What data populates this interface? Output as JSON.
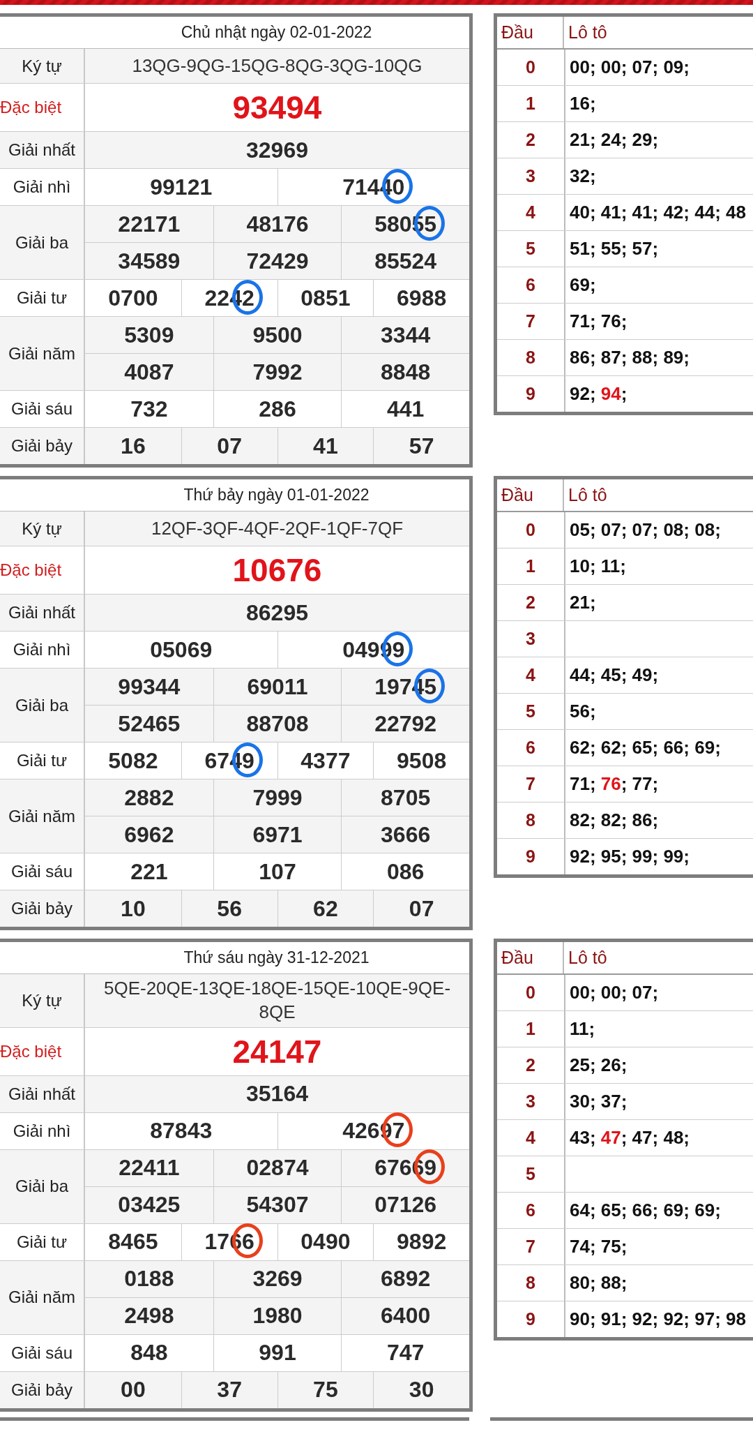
{
  "draws": [
    {
      "date_title": "Chủ nhật ngày 02-01-2022",
      "color": "#1a73e8",
      "prizes": [
        {
          "label": "Ký tự",
          "kind": "symbols",
          "rows": [
            [
              {
                "n": "13QG-9QG-15QG-8QG-3QG-10QG",
                "circled": false
              }
            ]
          ]
        },
        {
          "label": "Đặc biệt",
          "kind": "special",
          "rows": [
            [
              {
                "n": "93494",
                "circled": false
              }
            ]
          ]
        },
        {
          "label": "Giải nhất",
          "kind": "normal",
          "rows": [
            [
              {
                "n": "32969",
                "circled": false
              }
            ]
          ]
        },
        {
          "label": "Giải nhì",
          "kind": "normal",
          "rows": [
            [
              {
                "n": "99121",
                "circled": false
              },
              {
                "n": "71440",
                "circled": true
              }
            ]
          ]
        },
        {
          "label": "Giải ba",
          "kind": "normal",
          "rows": [
            [
              {
                "n": "22171",
                "circled": false
              },
              {
                "n": "48176",
                "circled": false
              },
              {
                "n": "58055",
                "circled": true
              }
            ],
            [
              {
                "n": "34589",
                "circled": false
              },
              {
                "n": "72429",
                "circled": false
              },
              {
                "n": "85524",
                "circled": false
              }
            ]
          ]
        },
        {
          "label": "Giải tư",
          "kind": "normal",
          "rows": [
            [
              {
                "n": "0700",
                "circled": false
              },
              {
                "n": "2242",
                "circled": true
              },
              {
                "n": "0851",
                "circled": false
              },
              {
                "n": "6988",
                "circled": false
              }
            ]
          ]
        },
        {
          "label": "Giải năm",
          "kind": "normal",
          "rows": [
            [
              {
                "n": "5309",
                "circled": false
              },
              {
                "n": "9500",
                "circled": false
              },
              {
                "n": "3344",
                "circled": false
              }
            ],
            [
              {
                "n": "4087",
                "circled": false
              },
              {
                "n": "7992",
                "circled": false
              },
              {
                "n": "8848",
                "circled": false
              }
            ]
          ]
        },
        {
          "label": "Giải sáu",
          "kind": "normal",
          "rows": [
            [
              {
                "n": "732",
                "circled": false
              },
              {
                "n": "286",
                "circled": false
              },
              {
                "n": "441",
                "circled": false
              }
            ]
          ]
        },
        {
          "label": "Giải bảy",
          "kind": "normal",
          "rows": [
            [
              {
                "n": "16",
                "circled": false
              },
              {
                "n": "07",
                "circled": false
              },
              {
                "n": "41",
                "circled": false
              },
              {
                "n": "57",
                "circled": false
              }
            ]
          ]
        }
      ],
      "loto": {
        "head_label": "Đầu",
        "list_label": "Lô tô",
        "rows": [
          {
            "head": "0",
            "segments": [
              {
                "text": "00; 00; 07; 09;",
                "special": false
              }
            ]
          },
          {
            "head": "1",
            "segments": [
              {
                "text": "16;",
                "special": false
              }
            ]
          },
          {
            "head": "2",
            "segments": [
              {
                "text": "21; 24; 29;",
                "special": false
              }
            ]
          },
          {
            "head": "3",
            "segments": [
              {
                "text": "32;",
                "special": false
              }
            ]
          },
          {
            "head": "4",
            "segments": [
              {
                "text": "40; 41; 41; 42; 44; 48",
                "special": false
              }
            ]
          },
          {
            "head": "5",
            "segments": [
              {
                "text": "51; 55; 57;",
                "special": false
              }
            ]
          },
          {
            "head": "6",
            "segments": [
              {
                "text": "69;",
                "special": false
              }
            ]
          },
          {
            "head": "7",
            "segments": [
              {
                "text": "71; 76;",
                "special": false
              }
            ]
          },
          {
            "head": "8",
            "segments": [
              {
                "text": "86; 87; 88; 89;",
                "special": false
              }
            ]
          },
          {
            "head": "9",
            "segments": [
              {
                "text": "92; ",
                "special": false
              },
              {
                "text": "94",
                "special": true
              },
              {
                "text": ";",
                "special": false
              }
            ]
          }
        ]
      }
    },
    {
      "date_title": "Thứ bảy ngày 01-01-2022",
      "color": "#1a73e8",
      "prizes": [
        {
          "label": "Ký tự",
          "kind": "symbols",
          "rows": [
            [
              {
                "n": "12QF-3QF-4QF-2QF-1QF-7QF",
                "circled": false
              }
            ]
          ]
        },
        {
          "label": "Đặc biệt",
          "kind": "special",
          "rows": [
            [
              {
                "n": "10676",
                "circled": false
              }
            ]
          ]
        },
        {
          "label": "Giải nhất",
          "kind": "normal",
          "rows": [
            [
              {
                "n": "86295",
                "circled": false
              }
            ]
          ]
        },
        {
          "label": "Giải nhì",
          "kind": "normal",
          "rows": [
            [
              {
                "n": "05069",
                "circled": false
              },
              {
                "n": "04999",
                "circled": true
              }
            ]
          ]
        },
        {
          "label": "Giải ba",
          "kind": "normal",
          "rows": [
            [
              {
                "n": "99344",
                "circled": false
              },
              {
                "n": "69011",
                "circled": false
              },
              {
                "n": "19745",
                "circled": true
              }
            ],
            [
              {
                "n": "52465",
                "circled": false
              },
              {
                "n": "88708",
                "circled": false
              },
              {
                "n": "22792",
                "circled": false
              }
            ]
          ]
        },
        {
          "label": "Giải tư",
          "kind": "normal",
          "rows": [
            [
              {
                "n": "5082",
                "circled": false
              },
              {
                "n": "6749",
                "circled": true
              },
              {
                "n": "4377",
                "circled": false
              },
              {
                "n": "9508",
                "circled": false
              }
            ]
          ]
        },
        {
          "label": "Giải năm",
          "kind": "normal",
          "rows": [
            [
              {
                "n": "2882",
                "circled": false
              },
              {
                "n": "7999",
                "circled": false
              },
              {
                "n": "8705",
                "circled": false
              }
            ],
            [
              {
                "n": "6962",
                "circled": false
              },
              {
                "n": "6971",
                "circled": false
              },
              {
                "n": "3666",
                "circled": false
              }
            ]
          ]
        },
        {
          "label": "Giải sáu",
          "kind": "normal",
          "rows": [
            [
              {
                "n": "221",
                "circled": false
              },
              {
                "n": "107",
                "circled": false
              },
              {
                "n": "086",
                "circled": false
              }
            ]
          ]
        },
        {
          "label": "Giải bảy",
          "kind": "normal",
          "rows": [
            [
              {
                "n": "10",
                "circled": false
              },
              {
                "n": "56",
                "circled": false
              },
              {
                "n": "62",
                "circled": false
              },
              {
                "n": "07",
                "circled": false
              }
            ]
          ]
        }
      ],
      "loto": {
        "head_label": "Đầu",
        "list_label": "Lô tô",
        "rows": [
          {
            "head": "0",
            "segments": [
              {
                "text": "05; 07; 07; 08; 08;",
                "special": false
              }
            ]
          },
          {
            "head": "1",
            "segments": [
              {
                "text": "10; 11;",
                "special": false
              }
            ]
          },
          {
            "head": "2",
            "segments": [
              {
                "text": "21;",
                "special": false
              }
            ]
          },
          {
            "head": "3",
            "segments": []
          },
          {
            "head": "4",
            "segments": [
              {
                "text": "44; 45; 49;",
                "special": false
              }
            ]
          },
          {
            "head": "5",
            "segments": [
              {
                "text": "56;",
                "special": false
              }
            ]
          },
          {
            "head": "6",
            "segments": [
              {
                "text": "62; 62; 65; 66; 69;",
                "special": false
              }
            ]
          },
          {
            "head": "7",
            "segments": [
              {
                "text": "71; ",
                "special": false
              },
              {
                "text": "76",
                "special": true
              },
              {
                "text": "; 77;",
                "special": false
              }
            ]
          },
          {
            "head": "8",
            "segments": [
              {
                "text": "82; 82; 86;",
                "special": false
              }
            ]
          },
          {
            "head": "9",
            "segments": [
              {
                "text": "92; 95; 99; 99;",
                "special": false
              }
            ]
          }
        ]
      }
    },
    {
      "date_title": "Thứ sáu ngày 31-12-2021",
      "color": "#e8401c",
      "prizes": [
        {
          "label": "Ký tự",
          "kind": "symbols",
          "rows": [
            [
              {
                "n": "5QE-20QE-13QE-18QE-15QE-10QE-9QE-8QE",
                "circled": false
              }
            ]
          ]
        },
        {
          "label": "Đặc biệt",
          "kind": "special",
          "rows": [
            [
              {
                "n": "24147",
                "circled": false
              }
            ]
          ]
        },
        {
          "label": "Giải nhất",
          "kind": "normal",
          "rows": [
            [
              {
                "n": "35164",
                "circled": false
              }
            ]
          ]
        },
        {
          "label": "Giải nhì",
          "kind": "normal",
          "rows": [
            [
              {
                "n": "87843",
                "circled": false
              },
              {
                "n": "42697",
                "circled": true
              }
            ]
          ]
        },
        {
          "label": "Giải ba",
          "kind": "normal",
          "rows": [
            [
              {
                "n": "22411",
                "circled": false
              },
              {
                "n": "02874",
                "circled": false
              },
              {
                "n": "67669",
                "circled": true
              }
            ],
            [
              {
                "n": "03425",
                "circled": false
              },
              {
                "n": "54307",
                "circled": false
              },
              {
                "n": "07126",
                "circled": false
              }
            ]
          ]
        },
        {
          "label": "Giải tư",
          "kind": "normal",
          "rows": [
            [
              {
                "n": "8465",
                "circled": false
              },
              {
                "n": "1766",
                "circled": true
              },
              {
                "n": "0490",
                "circled": false
              },
              {
                "n": "9892",
                "circled": false
              }
            ]
          ]
        },
        {
          "label": "Giải năm",
          "kind": "normal",
          "rows": [
            [
              {
                "n": "0188",
                "circled": false
              },
              {
                "n": "3269",
                "circled": false
              },
              {
                "n": "6892",
                "circled": false
              }
            ],
            [
              {
                "n": "2498",
                "circled": false
              },
              {
                "n": "1980",
                "circled": false
              },
              {
                "n": "6400",
                "circled": false
              }
            ]
          ]
        },
        {
          "label": "Giải sáu",
          "kind": "normal",
          "rows": [
            [
              {
                "n": "848",
                "circled": false
              },
              {
                "n": "991",
                "circled": false
              },
              {
                "n": "747",
                "circled": false
              }
            ]
          ]
        },
        {
          "label": "Giải bảy",
          "kind": "normal",
          "rows": [
            [
              {
                "n": "00",
                "circled": false
              },
              {
                "n": "37",
                "circled": false
              },
              {
                "n": "75",
                "circled": false
              },
              {
                "n": "30",
                "circled": false
              }
            ]
          ]
        }
      ],
      "loto": {
        "head_label": "Đầu",
        "list_label": "Lô tô",
        "rows": [
          {
            "head": "0",
            "segments": [
              {
                "text": "00; 00; 07;",
                "special": false
              }
            ]
          },
          {
            "head": "1",
            "segments": [
              {
                "text": "11;",
                "special": false
              }
            ]
          },
          {
            "head": "2",
            "segments": [
              {
                "text": "25; 26;",
                "special": false
              }
            ]
          },
          {
            "head": "3",
            "segments": [
              {
                "text": "30; 37;",
                "special": false
              }
            ]
          },
          {
            "head": "4",
            "segments": [
              {
                "text": "43; ",
                "special": false
              },
              {
                "text": "47",
                "special": true
              },
              {
                "text": "; 47; 48;",
                "special": false
              }
            ]
          },
          {
            "head": "5",
            "segments": []
          },
          {
            "head": "6",
            "segments": [
              {
                "text": "64; 65; 66; 69; 69;",
                "special": false
              }
            ]
          },
          {
            "head": "7",
            "segments": [
              {
                "text": "74; 75;",
                "special": false
              }
            ]
          },
          {
            "head": "8",
            "segments": [
              {
                "text": "80; 88;",
                "special": false
              }
            ]
          },
          {
            "head": "9",
            "segments": [
              {
                "text": "90; 91; 92; 92; 97; 98",
                "special": false
              }
            ]
          }
        ]
      }
    }
  ]
}
